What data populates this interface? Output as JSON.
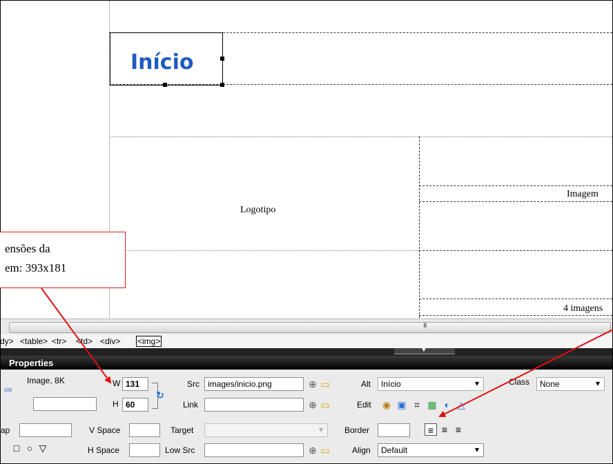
{
  "design": {
    "logo_image_text": "Início",
    "logotipo_label": "Logotipo",
    "imagem_label": "Imagem",
    "imagens_label": "4 imagens"
  },
  "callout": {
    "line1": "ensões da",
    "line2": "em: 393x181"
  },
  "scrollbar": {
    "grip": "III"
  },
  "tagbar": {
    "items": [
      "dy>",
      "<table>",
      "<tr>",
      "<td>",
      "<div>",
      "<img>"
    ]
  },
  "properties": {
    "title": "Properties",
    "image_info": "Image, 8K",
    "id_hint": "cio",
    "w_label": "W",
    "w_value": "131",
    "h_label": "H",
    "h_value": "60",
    "src_label": "Src",
    "src_value": "images/inicio.png",
    "link_label": "Link",
    "link_value": "",
    "alt_label": "Alt",
    "alt_value": "Início",
    "edit_label": "Edit",
    "class_label": "Class",
    "class_value": "None",
    "map_label": "ap",
    "vspace_label": "V Space",
    "hspace_label": "H Space",
    "target_label": "Target",
    "lowsrc_label": "Low Src",
    "border_label": "Border",
    "align_label": "Align",
    "align_value": "Default"
  },
  "colors": {
    "callout_border": "#d32020",
    "arrow": "#e01010",
    "logo_text": "#1f5bbf"
  }
}
